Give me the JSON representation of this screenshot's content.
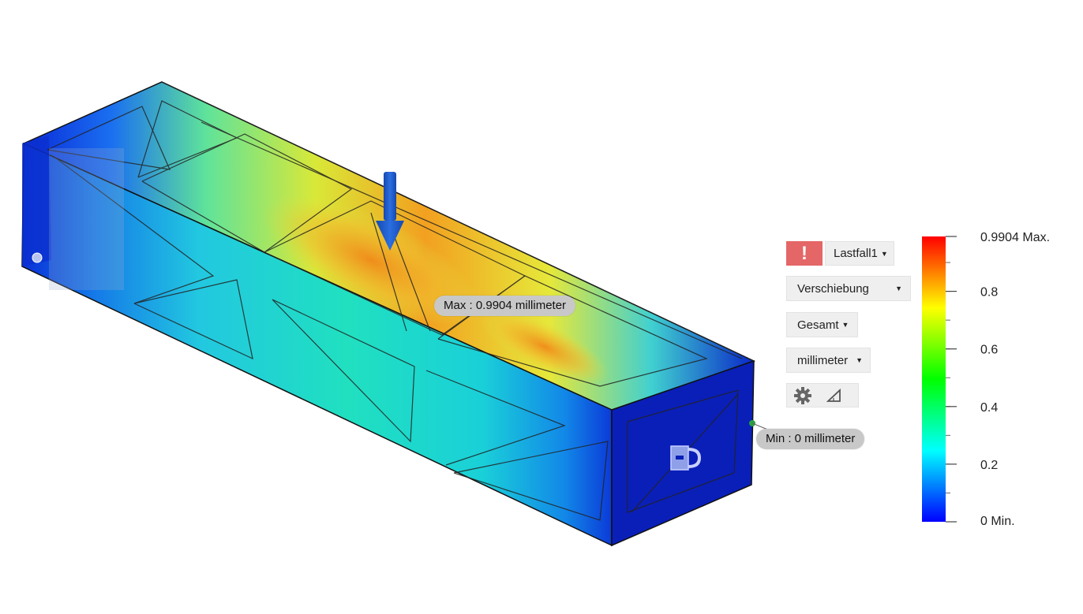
{
  "probes": {
    "max_label": "Max : 0.9904 millimeter",
    "min_label": "Min : 0 millimeter"
  },
  "panel": {
    "warning_icon": "!",
    "load_case": "Lastfall1",
    "result_type": "Verschiebung",
    "component": "Gesamt",
    "unit": "millimeter",
    "settings_icon": "gear-icon",
    "probe_icon": "triangle-ruler-icon",
    "warning_color": "#e46666"
  },
  "legend": {
    "max_label": "0.9904 Max.",
    "ticks": [
      "0.8",
      "0.6",
      "0.4",
      "0.2"
    ],
    "min_label": "0 Min.",
    "min_value": 0,
    "max_value": 0.9904,
    "tick_values": [
      0.8,
      0.6,
      0.4,
      0.2
    ],
    "colors": [
      "#0000ff",
      "#00ffff",
      "#00ff00",
      "#ffff00",
      "#ff0000"
    ]
  }
}
